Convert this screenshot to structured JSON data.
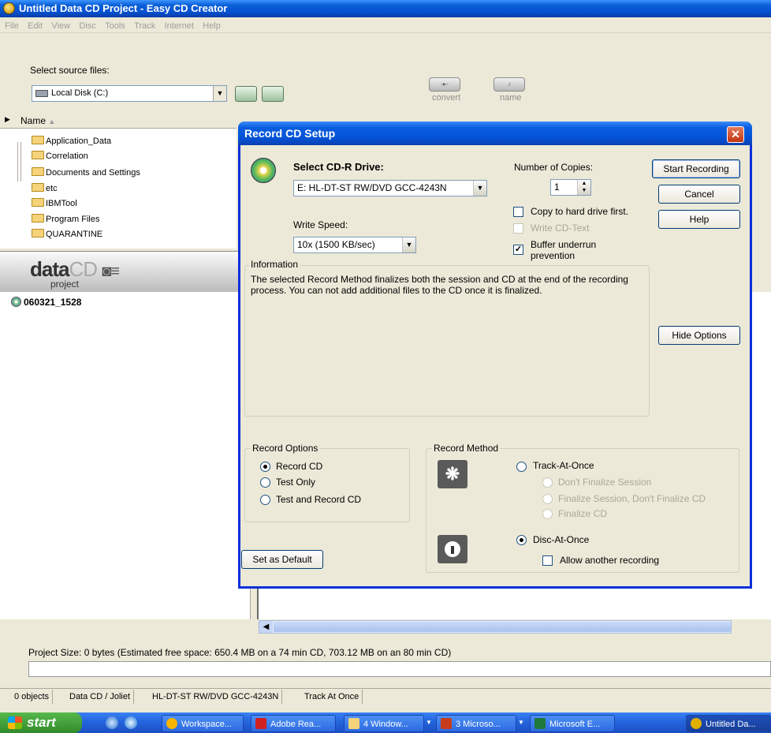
{
  "window": {
    "title": "Untitled Data CD Project - Easy CD Creator"
  },
  "menu": [
    "File",
    "Edit",
    "View",
    "Disc",
    "Tools",
    "Track",
    "Internet",
    "Help"
  ],
  "source": {
    "label": "Select source files:",
    "drive": "Local Disk (C:)",
    "convert_label": "convert",
    "name_label": "name"
  },
  "list": {
    "name_header": "Name",
    "folders": [
      "Application_Data",
      "Correlation",
      "Documents and Settings",
      "etc",
      "IBMTool",
      "Program Files",
      "QUARANTINE"
    ]
  },
  "project": {
    "logo_data": "data",
    "logo_cd": "CD",
    "logo_sub": "project",
    "item": "060321_1528"
  },
  "status": {
    "project_size": "Project Size: 0 bytes  (Estimated free space: 650.4 MB on a 74 min CD,  703.12 MB on an 80 min CD)",
    "cells": [
      "0 objects",
      "Data CD / Joliet",
      "HL-DT-ST RW/DVD GCC-4243N",
      "Track At Once"
    ]
  },
  "taskbar": {
    "start": "start",
    "items": [
      "Workspace...",
      "Adobe Rea...",
      "4 Window...",
      "3 Microso...",
      "Microsoft E...",
      "Untitled Da..."
    ]
  },
  "dialog": {
    "title": "Record CD Setup",
    "select_drive_label": "Select CD-R Drive:",
    "drive_value": "E: HL-DT-ST RW/DVD GCC-4243N",
    "write_speed_label": "Write Speed:",
    "write_speed_value": "10x (1500 KB/sec)",
    "copies_label": "Number of Copies:",
    "copies_value": "1",
    "copy_hdd": "Copy to hard drive first.",
    "write_cdtext": "Write CD-Text",
    "buffer_line1": "Buffer underrun",
    "buffer_line2": "prevention",
    "info_title": "Information",
    "info_text": "The selected Record Method finalizes both the session and CD at the end of the recording process. You can not add additional files to the CD once it is finalized.",
    "buttons": {
      "start": "Start Recording",
      "cancel": "Cancel",
      "help": "Help",
      "hide": "Hide Options",
      "default": "Set as Default"
    },
    "record_options": {
      "title": "Record Options",
      "items": [
        "Record CD",
        "Test Only",
        "Test and Record CD"
      ],
      "selected": "Record CD"
    },
    "record_method": {
      "title": "Record Method",
      "track_at_once": "Track-At-Once",
      "tao_sub": [
        "Don't Finalize Session",
        "Finalize Session, Don't Finalize CD",
        "Finalize CD"
      ],
      "disc_at_once": "Disc-At-Once",
      "allow_another": "Allow another recording",
      "selected": "Disc-At-Once"
    }
  }
}
